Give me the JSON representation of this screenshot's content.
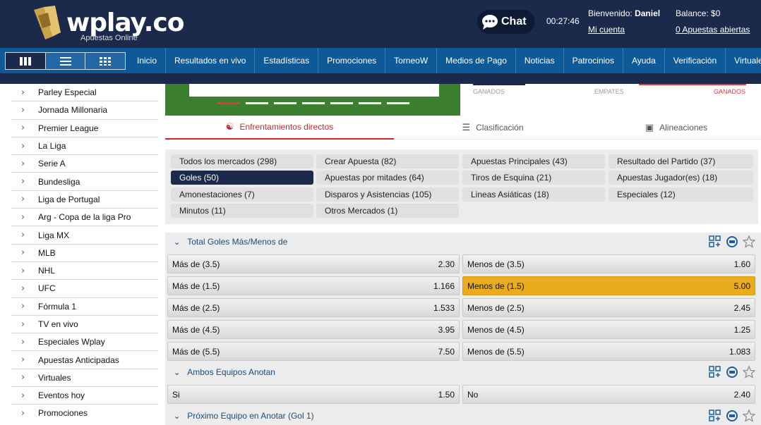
{
  "header": {
    "logo_text": "wplay.co",
    "logo_sub": "Apuestas Online",
    "chat_label": "Chat",
    "clock": "00:27:46",
    "welcome_prefix": "Bienvenido:",
    "user_name": "Daniel",
    "account_link": "Mi cuenta",
    "balance": "Balance: $0",
    "open_bets": "0 Apuestas abiertas"
  },
  "nav": [
    "Inicio",
    "Resultados en vivo",
    "Estadísticas",
    "Promociones",
    "TorneoW",
    "Medios de Pago",
    "Noticias",
    "Patrocinios",
    "Ayuda",
    "Verificación",
    "Virtuales"
  ],
  "sidebar": [
    "Parley Especial",
    "Jornada Millonaria",
    "Premier League",
    "La Liga",
    "Serie A",
    "Bundesliga",
    "Liga de Portugal",
    "Arg - Copa de la liga Pro",
    "Liga MX",
    "MLB",
    "NHL",
    "UFC",
    "Fórmula 1",
    "TV en vivo",
    "Especiales Wplay",
    "Apuestas Anticipadas",
    "Virtuales",
    "Eventos hoy",
    "Promociones"
  ],
  "stats_labels": {
    "won_left": "GANADOS",
    "draws": "EMPATES",
    "won_right": "GANADOS"
  },
  "tabs": [
    "Enfrentamientos directos",
    "Clasificación",
    "Alineaciones"
  ],
  "filters": [
    "Todos los mercados (298)",
    "Crear Apuesta (82)",
    "Apuestas Principales (43)",
    "Resultado del Partido (37)",
    "Goles (50)",
    "Apuestas por mitades (64)",
    "Tiros de Esquina (21)",
    "Apuestas Jugador(es) (18)",
    "Amonestaciones (7)",
    "Disparos y Asistencias (105)",
    "Lineas Asiáticas (18)",
    "Especiales (12)",
    "Minutos (11)",
    "Otros Mercados (1)"
  ],
  "colors": {
    "header": "#1b2a4a",
    "nav": "#0e5a99",
    "selected_odd": "#e8ac1d",
    "accent_red": "#c62828"
  },
  "markets": [
    {
      "title": "Total Goles Más/Menos de",
      "rows": [
        [
          {
            "label": "Más de (3.5)",
            "odd": "2.30"
          },
          {
            "label": "Menos de (3.5)",
            "odd": "1.60"
          }
        ],
        [
          {
            "label": "Más de (1.5)",
            "odd": "1.166"
          },
          {
            "label": "Menos de (1.5)",
            "odd": "5.00"
          }
        ],
        [
          {
            "label": "Más de (2.5)",
            "odd": "1.533"
          },
          {
            "label": "Menos de (2.5)",
            "odd": "2.45"
          }
        ],
        [
          {
            "label": "Más de (4.5)",
            "odd": "3.95"
          },
          {
            "label": "Menos de (4.5)",
            "odd": "1.25"
          }
        ],
        [
          {
            "label": "Más de (5.5)",
            "odd": "7.50"
          },
          {
            "label": "Menos de (5.5)",
            "odd": "1.083"
          }
        ]
      ]
    },
    {
      "title": "Ambos Equipos Anotan",
      "rows": [
        [
          {
            "label": "Si",
            "odd": "1.50"
          },
          {
            "label": "No",
            "odd": "2.40"
          }
        ]
      ]
    },
    {
      "title": "Próximo Equipo en Anotar (Gol 1)",
      "rows": []
    }
  ]
}
